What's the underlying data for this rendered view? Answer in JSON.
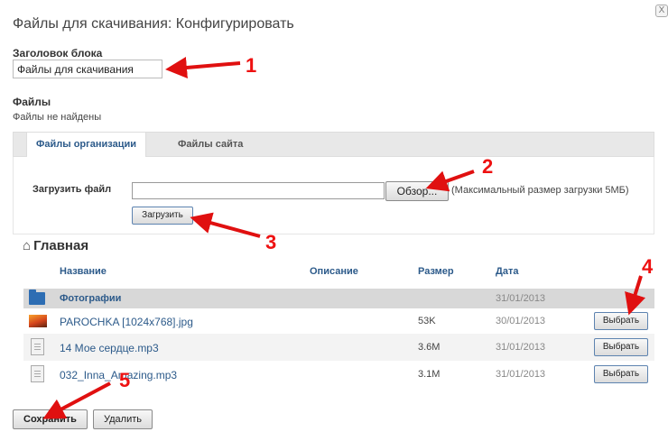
{
  "dialog": {
    "title": "Файлы для скачивания: Конфигурировать",
    "close_label": "X"
  },
  "block_title": {
    "label": "Заголовок блока",
    "value": "Файлы для скачивания"
  },
  "files": {
    "label": "Файлы",
    "empty_text": "Файлы не найдены"
  },
  "tabs": [
    {
      "label": "Файлы организации",
      "active": true
    },
    {
      "label": "Файлы сайта",
      "active": false
    }
  ],
  "upload": {
    "label": "Загрузить файл",
    "file_value": "",
    "browse_label": "Обзор...",
    "max_size_note": "(Максимальный размер загрузки 5МБ)",
    "upload_label": "Загрузить"
  },
  "breadcrumb": {
    "icon": "home-icon",
    "label": "Главная"
  },
  "table": {
    "headers": {
      "name": "Название",
      "description": "Описание",
      "size": "Размер",
      "date": "Дата"
    },
    "folder": {
      "name": "Фотографии",
      "date": "31/01/2013",
      "icon": "folder-icon"
    },
    "rows": [
      {
        "name": "PAROCHKA [1024x768].jpg",
        "size": "53K",
        "date": "30/01/2013",
        "action": "Выбрать",
        "icon": "image-icon"
      },
      {
        "name": "14 Мое сердце.mp3",
        "size": "3.6M",
        "date": "31/01/2013",
        "action": "Выбрать",
        "icon": "document-icon"
      },
      {
        "name": "032_Inna_Amazing.mp3",
        "size": "3.1M",
        "date": "31/01/2013",
        "action": "Выбрать",
        "icon": "document-icon"
      }
    ]
  },
  "footer": {
    "save_label": "Сохранить",
    "delete_label": "Удалить"
  },
  "annotations": {
    "color": "#e01010",
    "markers": [
      "1",
      "2",
      "3",
      "4",
      "5"
    ]
  }
}
